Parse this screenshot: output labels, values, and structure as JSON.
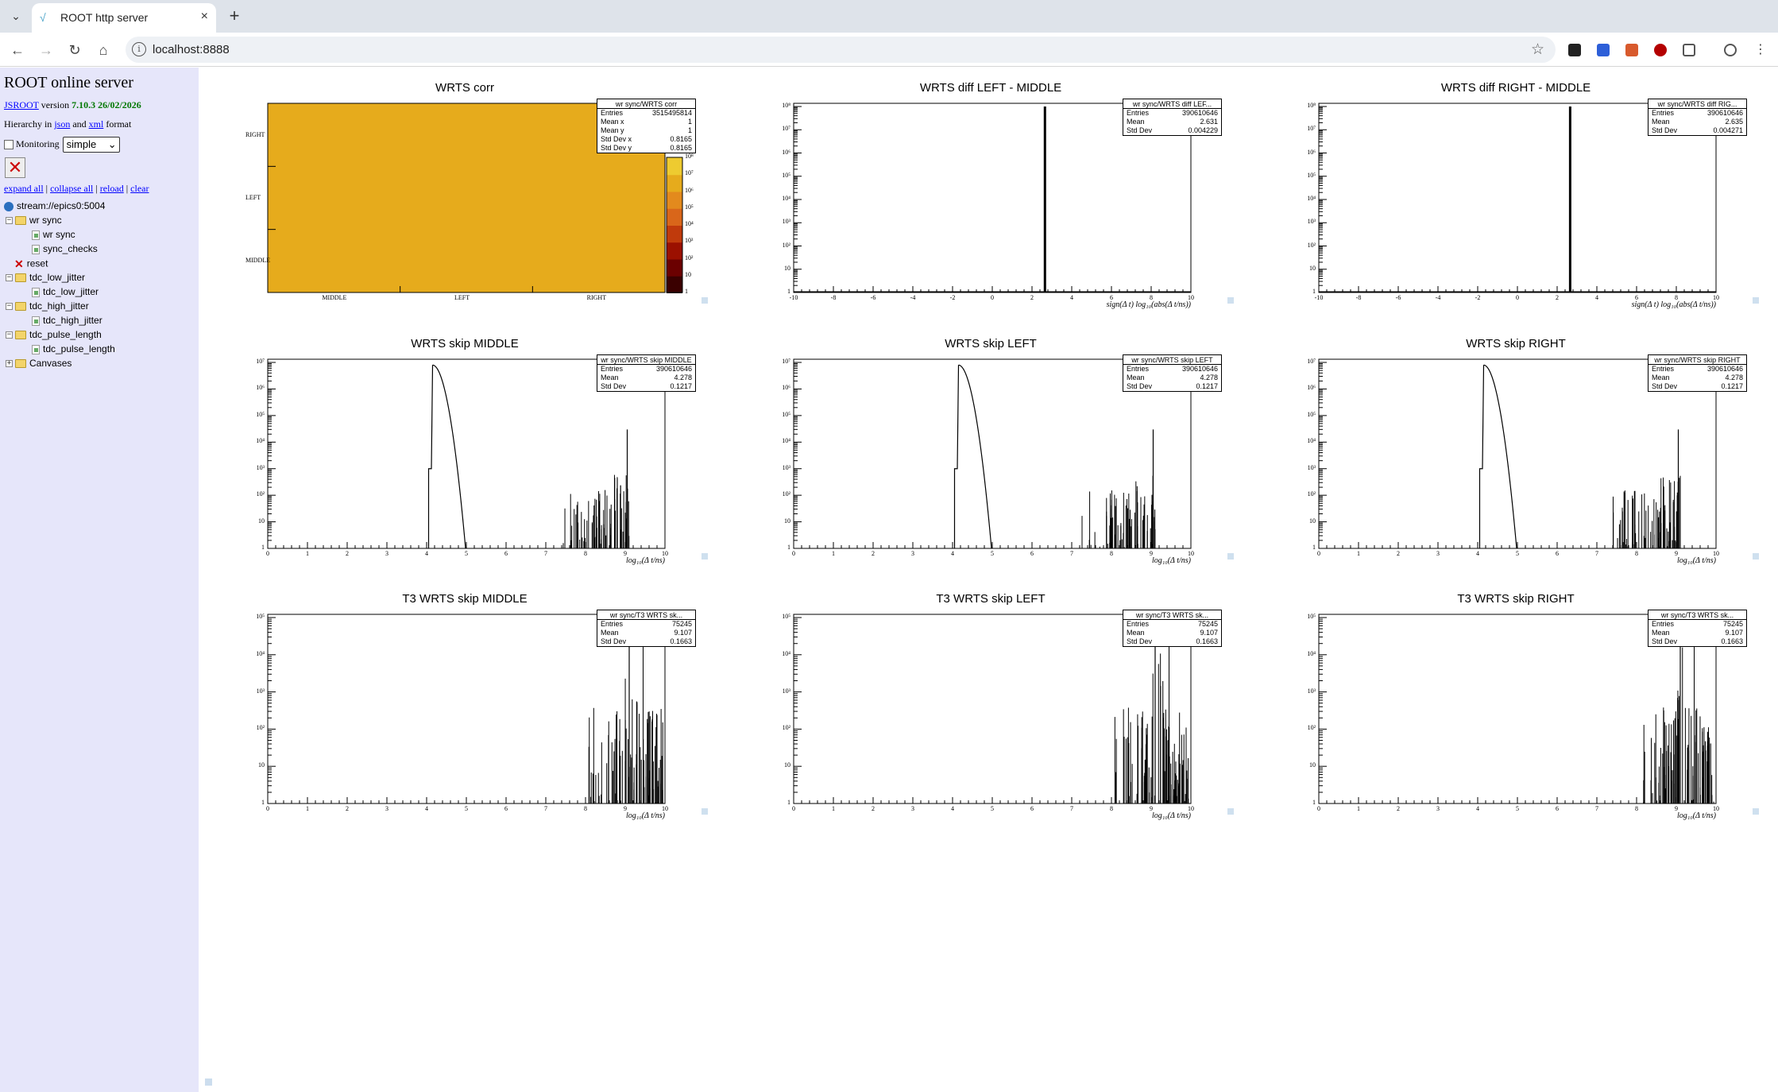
{
  "browser": {
    "tab_title": "ROOT http server",
    "url": "localhost:8888"
  },
  "sidebar": {
    "title": "ROOT online server",
    "jsroot": "JSROOT",
    "version_word": "version",
    "version": "7.10.3 26/02/2026",
    "hier_prefix": "Hierarchy in",
    "json": "json",
    "and": "and",
    "xml": "xml",
    "format": "format",
    "monitoring": "Monitoring",
    "mode": "simple",
    "links": [
      "expand all",
      "collapse all",
      "reload",
      "clear"
    ],
    "tree": [
      {
        "label": "stream://epics0:5004",
        "kind": "globe",
        "level": 0
      },
      {
        "label": "wr sync",
        "kind": "folder",
        "level": 0,
        "toggle": "−"
      },
      {
        "label": "wr sync",
        "kind": "file",
        "level": 2
      },
      {
        "label": "sync_checks",
        "kind": "file",
        "level": 2
      },
      {
        "label": "reset",
        "kind": "cmd",
        "level": 1
      },
      {
        "label": "tdc_low_jitter",
        "kind": "folder",
        "level": 0,
        "toggle": "−"
      },
      {
        "label": "tdc_low_jitter",
        "kind": "file",
        "level": 2
      },
      {
        "label": "tdc_high_jitter",
        "kind": "folder",
        "level": 0,
        "toggle": "−"
      },
      {
        "label": "tdc_high_jitter",
        "kind": "file",
        "level": 2
      },
      {
        "label": "tdc_pulse_length",
        "kind": "folder",
        "level": 0,
        "toggle": "−"
      },
      {
        "label": "tdc_pulse_length",
        "kind": "file",
        "level": 2
      },
      {
        "label": "Canvases",
        "kind": "folder",
        "level": 0,
        "toggle": "+"
      }
    ]
  },
  "chart_data": [
    {
      "type": "heatmap",
      "title": "WRTS corr",
      "xcats": [
        "MIDDLE",
        "LEFT",
        "RIGHT"
      ],
      "ycats": [
        "MIDDLE",
        "LEFT",
        "RIGHT"
      ],
      "zlog": true,
      "palette_ticks": [
        "1",
        "10",
        "10²",
        "10³",
        "10⁴",
        "10⁵",
        "10⁶",
        "10⁷",
        "10⁸"
      ],
      "stats": {
        "name": "wr sync/WRTS corr",
        "rows": [
          [
            "Entries",
            "3515495814"
          ],
          [
            "Mean x",
            "1"
          ],
          [
            "Mean y",
            "1"
          ],
          [
            "Std Dev x",
            "0.8165"
          ],
          [
            "Std Dev y",
            "0.8165"
          ]
        ]
      }
    },
    {
      "type": "bar",
      "title": "WRTS diff LEFT - MIDDLE",
      "xlabel": "sign(Δ t) log₁₀(abs(Δ t/ns))",
      "xlim": [
        -10,
        10
      ],
      "ylog": true,
      "ylim": [
        1,
        100000000.0
      ],
      "xticks": [
        "-10",
        "-8",
        "-6",
        "-4",
        "-2",
        "0",
        "2",
        "4",
        "6",
        "8",
        "10"
      ],
      "yticks": [
        "1",
        "10",
        "10²",
        "10³",
        "10⁴",
        "10⁵",
        "10⁶",
        "10⁷",
        "10⁸"
      ],
      "peaks": [
        {
          "x": 2.631,
          "y": 100000000.0
        }
      ],
      "stats": {
        "name": "wr sync/WRTS diff LEF...",
        "rows": [
          [
            "Entries",
            "390610646"
          ],
          [
            "Mean",
            "2.631"
          ],
          [
            "Std Dev",
            "0.004229"
          ]
        ]
      }
    },
    {
      "type": "bar",
      "title": "WRTS diff RIGHT - MIDDLE",
      "xlabel": "sign(Δ t) log₁₀(abs(Δ t/ns))",
      "xlim": [
        -10,
        10
      ],
      "ylog": true,
      "ylim": [
        1,
        100000000.0
      ],
      "xticks": [
        "-10",
        "-8",
        "-6",
        "-4",
        "-2",
        "0",
        "2",
        "4",
        "6",
        "8",
        "10"
      ],
      "yticks": [
        "1",
        "10",
        "10²",
        "10³",
        "10⁴",
        "10⁵",
        "10⁶",
        "10⁷",
        "10⁸"
      ],
      "peaks": [
        {
          "x": 2.635,
          "y": 100000000.0
        }
      ],
      "stats": {
        "name": "wr sync/WRTS diff RIG...",
        "rows": [
          [
            "Entries",
            "390610646"
          ],
          [
            "Mean",
            "2.635"
          ],
          [
            "Std Dev",
            "0.004271"
          ]
        ]
      }
    },
    {
      "type": "line",
      "title": "WRTS skip MIDDLE",
      "xlabel": "log₁₀(Δ t/ns)",
      "xlim": [
        0,
        10
      ],
      "ylog": true,
      "ylim": [
        1,
        10000000.0
      ],
      "xticks": [
        "0",
        "1",
        "2",
        "3",
        "4",
        "5",
        "6",
        "7",
        "8",
        "9",
        "10"
      ],
      "yticks": [
        "1",
        "10",
        "10²",
        "10³",
        "10⁴",
        "10⁵",
        "10⁶",
        "10⁷"
      ],
      "stats": {
        "name": "wr sync/WRTS skip MIDDLE",
        "rows": [
          [
            "Entries",
            "390610646"
          ],
          [
            "Mean",
            "4.278"
          ],
          [
            "Std Dev",
            "0.1217"
          ]
        ]
      }
    },
    {
      "type": "line",
      "title": "WRTS skip LEFT",
      "xlabel": "log₁₀(Δ t/ns)",
      "xlim": [
        0,
        10
      ],
      "ylog": true,
      "ylim": [
        1,
        10000000.0
      ],
      "xticks": [
        "0",
        "1",
        "2",
        "3",
        "4",
        "5",
        "6",
        "7",
        "8",
        "9",
        "10"
      ],
      "yticks": [
        "1",
        "10",
        "10²",
        "10³",
        "10⁴",
        "10⁵",
        "10⁶",
        "10⁷"
      ],
      "stats": {
        "name": "wr sync/WRTS skip LEFT",
        "rows": [
          [
            "Entries",
            "390610646"
          ],
          [
            "Mean",
            "4.278"
          ],
          [
            "Std Dev",
            "0.1217"
          ]
        ]
      }
    },
    {
      "type": "line",
      "title": "WRTS skip RIGHT",
      "xlabel": "log₁₀(Δ t/ns)",
      "xlim": [
        0,
        10
      ],
      "ylog": true,
      "ylim": [
        1,
        10000000.0
      ],
      "xticks": [
        "0",
        "1",
        "2",
        "3",
        "4",
        "5",
        "6",
        "7",
        "8",
        "9",
        "10"
      ],
      "yticks": [
        "1",
        "10",
        "10²",
        "10³",
        "10⁴",
        "10⁵",
        "10⁶",
        "10⁷"
      ],
      "stats": {
        "name": "wr sync/WRTS skip RIGHT",
        "rows": [
          [
            "Entries",
            "390610646"
          ],
          [
            "Mean",
            "4.278"
          ],
          [
            "Std Dev",
            "0.1217"
          ]
        ]
      }
    },
    {
      "type": "bar",
      "title": "T3 WRTS skip MIDDLE",
      "xlabel": "log₁₀(Δ t/ns)",
      "xlim": [
        0,
        10
      ],
      "ylog": true,
      "ylim": [
        1,
        100000.0
      ],
      "xticks": [
        "0",
        "1",
        "2",
        "3",
        "4",
        "5",
        "6",
        "7",
        "8",
        "9",
        "10"
      ],
      "yticks": [
        "1",
        "10",
        "10²",
        "10³",
        "10⁴",
        "10⁵"
      ],
      "stats": {
        "name": "wr sync/T3 WRTS sk...",
        "rows": [
          [
            "Entries",
            "75245"
          ],
          [
            "Mean",
            "9.107"
          ],
          [
            "Std Dev",
            "0.1663"
          ]
        ]
      }
    },
    {
      "type": "bar",
      "title": "T3 WRTS skip LEFT",
      "xlabel": "log₁₀(Δ t/ns)",
      "xlim": [
        0,
        10
      ],
      "ylog": true,
      "ylim": [
        1,
        100000.0
      ],
      "xticks": [
        "0",
        "1",
        "2",
        "3",
        "4",
        "5",
        "6",
        "7",
        "8",
        "9",
        "10"
      ],
      "yticks": [
        "1",
        "10",
        "10²",
        "10³",
        "10⁴",
        "10⁵"
      ],
      "stats": {
        "name": "wr sync/T3 WRTS sk...",
        "rows": [
          [
            "Entries",
            "75245"
          ],
          [
            "Mean",
            "9.107"
          ],
          [
            "Std Dev",
            "0.1663"
          ]
        ]
      }
    },
    {
      "type": "bar",
      "title": "T3 WRTS skip RIGHT",
      "xlabel": "log₁₀(Δ t/ns)",
      "xlim": [
        0,
        10
      ],
      "ylog": true,
      "ylim": [
        1,
        100000.0
      ],
      "xticks": [
        "0",
        "1",
        "2",
        "3",
        "4",
        "5",
        "6",
        "7",
        "8",
        "9",
        "10"
      ],
      "yticks": [
        "1",
        "10",
        "10²",
        "10³",
        "10⁴",
        "10⁵"
      ],
      "stats": {
        "name": "wr sync/T3 WRTS sk...",
        "rows": [
          [
            "Entries",
            "75245"
          ],
          [
            "Mean",
            "9.107"
          ],
          [
            "Std Dev",
            "0.1663"
          ]
        ]
      }
    }
  ]
}
